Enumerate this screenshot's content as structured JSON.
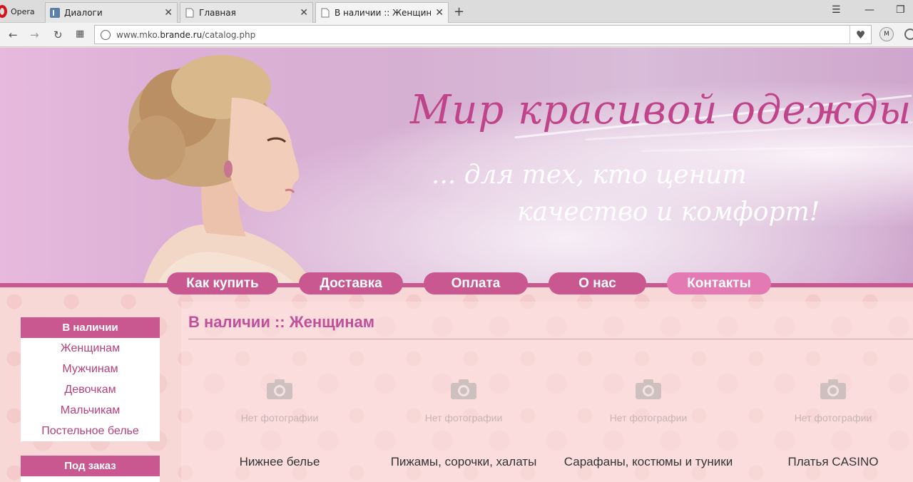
{
  "browser": {
    "app_label": "Opera",
    "tabs": [
      {
        "title": "Диалоги"
      },
      {
        "title": "Главная"
      },
      {
        "title": "В наличии :: Женщинам"
      }
    ],
    "url_prefix": "www.mko.",
    "url_domain": "brande.ru",
    "url_path": "/catalog.php"
  },
  "banner": {
    "slogan_main": "Мир красивой одежды...",
    "slogan_line2": "... для тех, кто ценит",
    "slogan_line3": "качество и комфорт!"
  },
  "menu": {
    "items": [
      {
        "label": "Как купить"
      },
      {
        "label": "Доставка"
      },
      {
        "label": "Оплата"
      },
      {
        "label": "О нас"
      },
      {
        "label": "Контакты"
      }
    ]
  },
  "sidebar": {
    "in_stock": {
      "heading": "В наличии",
      "items": [
        {
          "label": "Женщинам"
        },
        {
          "label": "Мужчинам"
        },
        {
          "label": "Девочкам"
        },
        {
          "label": "Мальчикам"
        },
        {
          "label": "Постельное белье"
        }
      ]
    },
    "to_order": {
      "heading": "Под заказ"
    }
  },
  "content": {
    "title": "В наличии :: Женщинам",
    "no_photo_label": "Нет фотографии",
    "categories": [
      {
        "name": "Нижнее белье"
      },
      {
        "name": "Пижамы, сорочки, халаты"
      },
      {
        "name": "Сарафаны, костюмы и туники"
      },
      {
        "name": "Платья CASINO"
      }
    ]
  },
  "colors": {
    "accent": "#c8588f",
    "accent_light": "#e37ab4",
    "link": "#b8407d",
    "title": "#c0509a"
  }
}
